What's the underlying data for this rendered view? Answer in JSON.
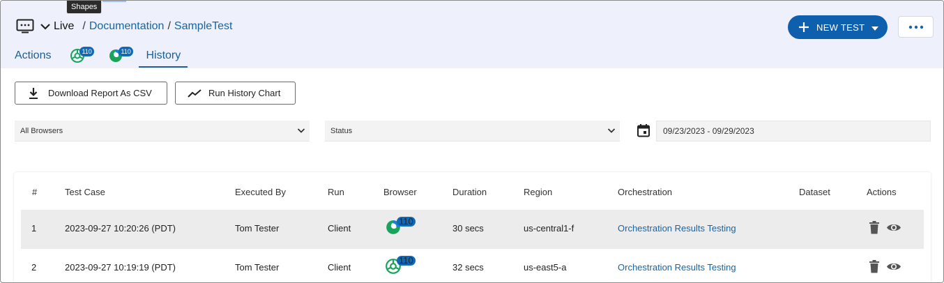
{
  "tooltip": "Shapes",
  "breadcrumb": {
    "mode": "Live",
    "separator": "/",
    "project": "Documentation",
    "test": "SampleTest"
  },
  "tabs": {
    "actions": "Actions",
    "browser_badge_1": "110",
    "browser_badge_2": "110",
    "history": "History"
  },
  "toolbar": {
    "new_test_label": "NEW TEST",
    "download_label": "Download Report As CSV",
    "run_history_label": "Run History Chart"
  },
  "filters": {
    "browsers": "All Browsers",
    "status": "Status",
    "date_range": "09/23/2023 - 09/29/2023"
  },
  "table": {
    "headers": [
      "#",
      "Test Case",
      "Executed By",
      "Run",
      "Browser",
      "Duration",
      "Region",
      "Orchestration",
      "Dataset",
      "Actions"
    ],
    "rows": [
      {
        "num": "1",
        "test_case": "2023-09-27 10:20:26 (PDT)",
        "executed_by": "Tom Tester",
        "run": "Client",
        "browser": "edge-icon",
        "browser_version": "110",
        "duration": "30 secs",
        "region": "us-central1-f",
        "orchestration": "Orchestration Results Testing",
        "dataset": ""
      },
      {
        "num": "2",
        "test_case": "2023-09-27 10:19:19 (PDT)",
        "executed_by": "Tom Tester",
        "run": "Client",
        "browser": "chrome-icon",
        "browser_version": "110",
        "duration": "32 secs",
        "region": "us-east5-a",
        "orchestration": "Orchestration Results Testing",
        "dataset": ""
      }
    ]
  },
  "colors": {
    "accent": "#0e5fad",
    "link": "#1565a8",
    "header_bg": "#eef1fb",
    "browser_green": "#1aa35a"
  }
}
